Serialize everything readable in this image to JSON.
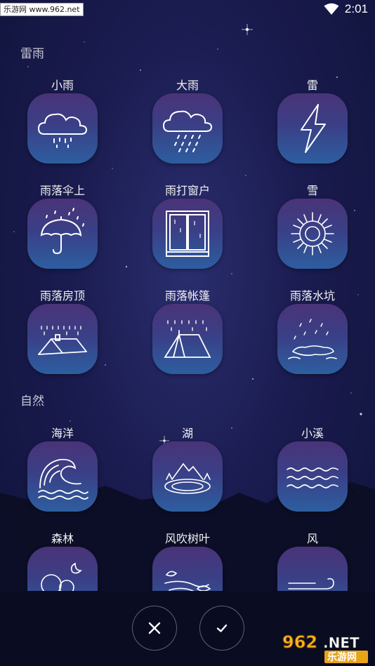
{
  "status_bar": {
    "site_badge": "乐游网 www.962.net",
    "time": "2:01"
  },
  "sections": [
    {
      "title": "雷雨"
    },
    {
      "title": "自然"
    }
  ],
  "tiles": {
    "light_rain": "小雨",
    "heavy_rain": "大雨",
    "thunder": "雷",
    "rain_on_umbrella": "雨落伞上",
    "rain_on_window": "雨打窗户",
    "snow": "雪",
    "rain_on_roof": "雨落房顶",
    "rain_on_tent": "雨落帐篷",
    "rain_puddle": "雨落水坑",
    "ocean": "海洋",
    "lake": "湖",
    "creek": "小溪",
    "forest": "森林",
    "wind_leaves": "风吹树叶",
    "wind": "风"
  },
  "actions": {
    "cancel_icon": "close-icon",
    "confirm_icon": "check-icon"
  },
  "watermark": {
    "big": "962.NET",
    "small": "乐游网"
  },
  "colors": {
    "tile_top": "#4a3378",
    "tile_bottom": "#2d5ea0",
    "background": "#1a1b4f"
  }
}
